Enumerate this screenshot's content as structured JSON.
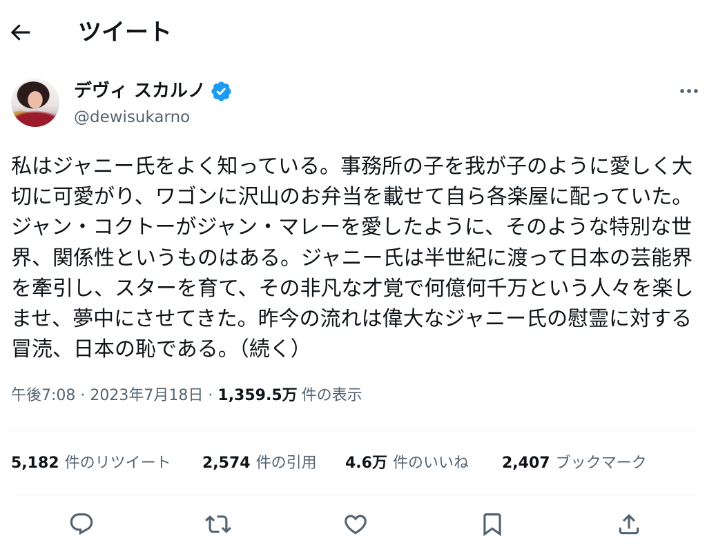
{
  "header": {
    "title": "ツイート",
    "back_icon": "arrow-left-icon"
  },
  "author": {
    "name": "デヴィ スカルノ",
    "handle": "@dewisukarno",
    "verified": true,
    "verified_icon": "verified-badge-icon",
    "more_icon": "more-horizontal-icon"
  },
  "tweet": {
    "text": "私はジャニー氏をよく知っている。事務所の子を我が子のように愛しく大切に可愛がり、ワゴンに沢山のお弁当を載せて自ら各楽屋に配っていた。ジャン・コクトーがジャン・マレーを愛したように、そのような特別な世界、関係性というものはある。ジャニー氏は半世紀に渡って日本の芸能界を牽引し、スターを育て、その非凡な才覚で何億何千万という人々を楽しませ、夢中にさせてきた。昨今の流れは偉大なジャニー氏の慰霊に対する冒涜、日本の恥である。（続く）"
  },
  "meta": {
    "time": "午後7:08",
    "separator": "·",
    "date": "2023年7月18日",
    "views_count": "1,359.5万",
    "views_label": "件の表示"
  },
  "stats": [
    {
      "count": "5,182",
      "label": "件のリツイート"
    },
    {
      "count": "2,574",
      "label": "件の引用"
    },
    {
      "count": "4.6万",
      "label": "件のいいね"
    },
    {
      "count": "2,407",
      "label": "ブックマーク"
    }
  ],
  "actions": [
    {
      "icon": "reply-icon"
    },
    {
      "icon": "retweet-icon"
    },
    {
      "icon": "like-heart-icon"
    },
    {
      "icon": "bookmark-icon"
    },
    {
      "icon": "share-icon"
    }
  ],
  "colors": {
    "text": "#0f1419",
    "secondary": "#536471",
    "verified": "#1d9bf0",
    "divider": "#eff3f4",
    "background": "#ffffff"
  }
}
